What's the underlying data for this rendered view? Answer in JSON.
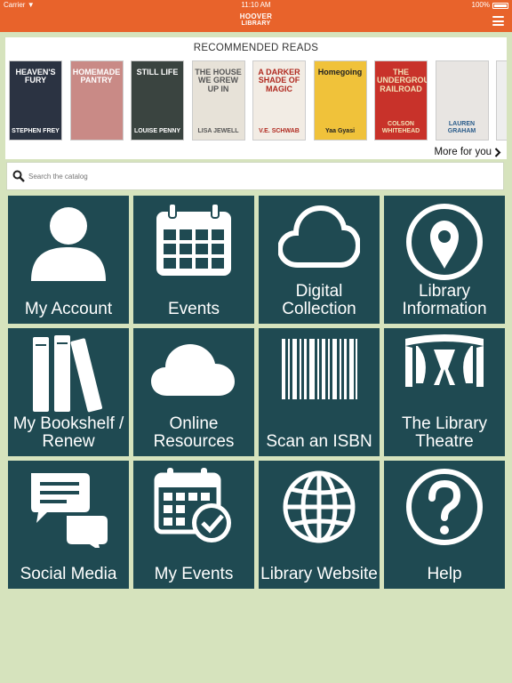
{
  "status": {
    "carrier": "Carrier",
    "time": "11:10 AM",
    "battery": "100%"
  },
  "nav": {
    "logo_line1": "HOOVER",
    "logo_line2": "LIBRARY"
  },
  "reads": {
    "title": "RECOMMENDED READS",
    "more": "More for you",
    "books": [
      {
        "title": "HEAVEN'S FURY",
        "author": "STEPHEN FREY",
        "bg": "#2b3342",
        "fg": "#ffffff"
      },
      {
        "title": "HOMEMADE PANTRY",
        "author": "",
        "bg": "#c98a86",
        "fg": "#ffffff"
      },
      {
        "title": "STILL LIFE",
        "author": "LOUISE PENNY",
        "bg": "#3a4440",
        "fg": "#ffffff"
      },
      {
        "title": "THE HOUSE WE GREW UP IN",
        "author": "LISA JEWELL",
        "bg": "#e7e2d8",
        "fg": "#555555"
      },
      {
        "title": "A DARKER SHADE OF MAGIC",
        "author": "V.E. SCHWAB",
        "bg": "#f2ece4",
        "fg": "#b02a20"
      },
      {
        "title": "Homegoing",
        "author": "Yaa Gyasi",
        "bg": "#f0c23a",
        "fg": "#222222"
      },
      {
        "title": "THE UNDERGROUND RAILROAD",
        "author": "COLSON WHITEHEAD",
        "bg": "#c8322a",
        "fg": "#f2e2b8"
      },
      {
        "title": "",
        "author": "LAUREN GRAHAM",
        "bg": "#e8e5e2",
        "fg": "#2a5c8a"
      },
      {
        "title": "",
        "author": "",
        "bg": "#eeeeee",
        "fg": "#555555"
      }
    ]
  },
  "search": {
    "placeholder": "Search the catalog"
  },
  "tiles": [
    {
      "label": "My Account",
      "icon": "person-icon"
    },
    {
      "label": "Events",
      "icon": "calendar-icon"
    },
    {
      "label": "Digital Collection",
      "icon": "cloud-outline-icon"
    },
    {
      "label": "Library Information",
      "icon": "location-pin-icon"
    },
    {
      "label": "My Bookshelf / Renew",
      "icon": "books-icon"
    },
    {
      "label": "Online Resources",
      "icon": "cloud-icon"
    },
    {
      "label": "Scan an ISBN",
      "icon": "barcode-icon"
    },
    {
      "label": "The Library Theatre",
      "icon": "theatre-icon"
    },
    {
      "label": "Social Media",
      "icon": "chat-bubbles-icon"
    },
    {
      "label": "My Events",
      "icon": "calendar-check-icon"
    },
    {
      "label": "Library Website",
      "icon": "globe-icon"
    },
    {
      "label": "Help",
      "icon": "question-icon"
    }
  ]
}
